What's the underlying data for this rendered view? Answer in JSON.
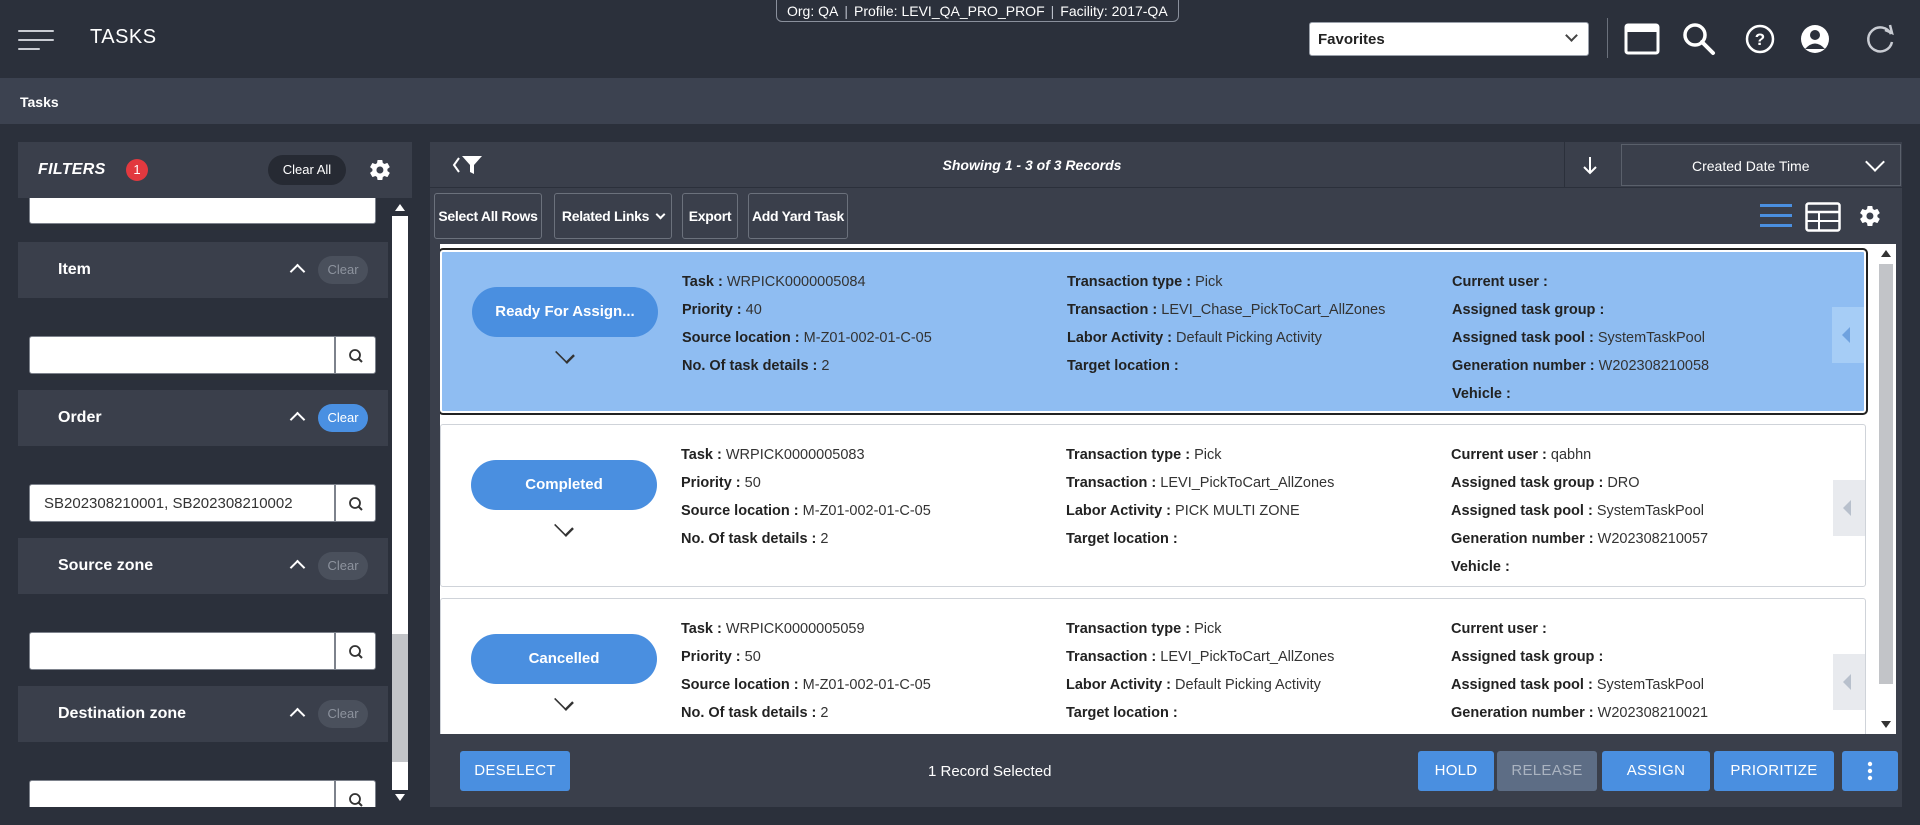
{
  "header": {
    "app_title": "TASKS",
    "context": {
      "org": "Org: QA",
      "profile": "Profile: LEVI_QA_PRO_PROF",
      "facility": "Facility: 2017-QA"
    },
    "favorites_label": "Favorites",
    "icons": [
      "window-icon",
      "search-icon",
      "help-icon",
      "user-icon",
      "refresh-icon"
    ]
  },
  "breadcrumb": "Tasks",
  "filters": {
    "title": "FILTERS",
    "count": "1",
    "clear_all": "Clear All",
    "sections": [
      {
        "label": "Item",
        "clear": "Clear",
        "active": false,
        "value": ""
      },
      {
        "label": "Order",
        "clear": "Clear",
        "active": true,
        "value": "SB202308210001, SB202308210002"
      },
      {
        "label": "Source zone",
        "clear": "Clear",
        "active": false,
        "value": ""
      },
      {
        "label": "Destination zone",
        "clear": "Clear",
        "active": false,
        "value": ""
      }
    ]
  },
  "main": {
    "showing": "Showing 1 - 3 of 3 Records",
    "sort_field": "Created Date Time",
    "toolbar": {
      "select_all": "Select All Rows",
      "related_links": "Related Links",
      "export": "Export",
      "add_yard_task": "Add Yard Task"
    },
    "labels": {
      "task": "Task :",
      "priority": "Priority :",
      "source_location": "Source location :",
      "task_details": "No. Of task details :",
      "transaction_type": "Transaction type :",
      "transaction": "Transaction :",
      "labor_activity": "Labor Activity :",
      "target_location": "Target location :",
      "current_user": "Current user :",
      "assigned_group": "Assigned task group :",
      "assigned_pool": "Assigned task pool :",
      "generation_number": "Generation number :",
      "vehicle": "Vehicle :"
    },
    "tasks": [
      {
        "status": "Ready For Assign...",
        "task": "WRPICK0000005084",
        "priority": "40",
        "source_location": "M-Z01-002-01-C-05",
        "task_details": "2",
        "transaction_type": "Pick",
        "transaction": "LEVI_Chase_PickToCart_AllZones",
        "labor_activity": "Default Picking Activity",
        "target_location": "",
        "current_user": "",
        "assigned_group": "",
        "assigned_pool": "SystemTaskPool",
        "generation_number": "W202308210058",
        "vehicle": ""
      },
      {
        "status": "Completed",
        "task": "WRPICK0000005083",
        "priority": "50",
        "source_location": "M-Z01-002-01-C-05",
        "task_details": "2",
        "transaction_type": "Pick",
        "transaction": "LEVI_PickToCart_AllZones",
        "labor_activity": "PICK MULTI ZONE",
        "target_location": "",
        "current_user": "qabhn",
        "assigned_group": "DRO",
        "assigned_pool": "SystemTaskPool",
        "generation_number": "W202308210057",
        "vehicle": ""
      },
      {
        "status": "Cancelled",
        "task": "WRPICK0000005059",
        "priority": "50",
        "source_location": "M-Z01-002-01-C-05",
        "task_details": "2",
        "transaction_type": "Pick",
        "transaction": "LEVI_PickToCart_AllZones",
        "labor_activity": "Default Picking Activity",
        "target_location": "",
        "current_user": "",
        "assigned_group": "",
        "assigned_pool": "SystemTaskPool",
        "generation_number": "W202308210021",
        "vehicle": ""
      }
    ],
    "footer": {
      "deselect": "DESELECT",
      "selected_text": "1 Record Selected",
      "hold": "HOLD",
      "release": "RELEASE",
      "assign": "ASSIGN",
      "prioritize": "PRIORITIZE"
    }
  },
  "colors": {
    "background": "#2b303b",
    "panel": "#3a3f4b",
    "accent": "#4a8fe0",
    "selected_row": "#8fbdf2",
    "badge_red": "#e2393f"
  }
}
